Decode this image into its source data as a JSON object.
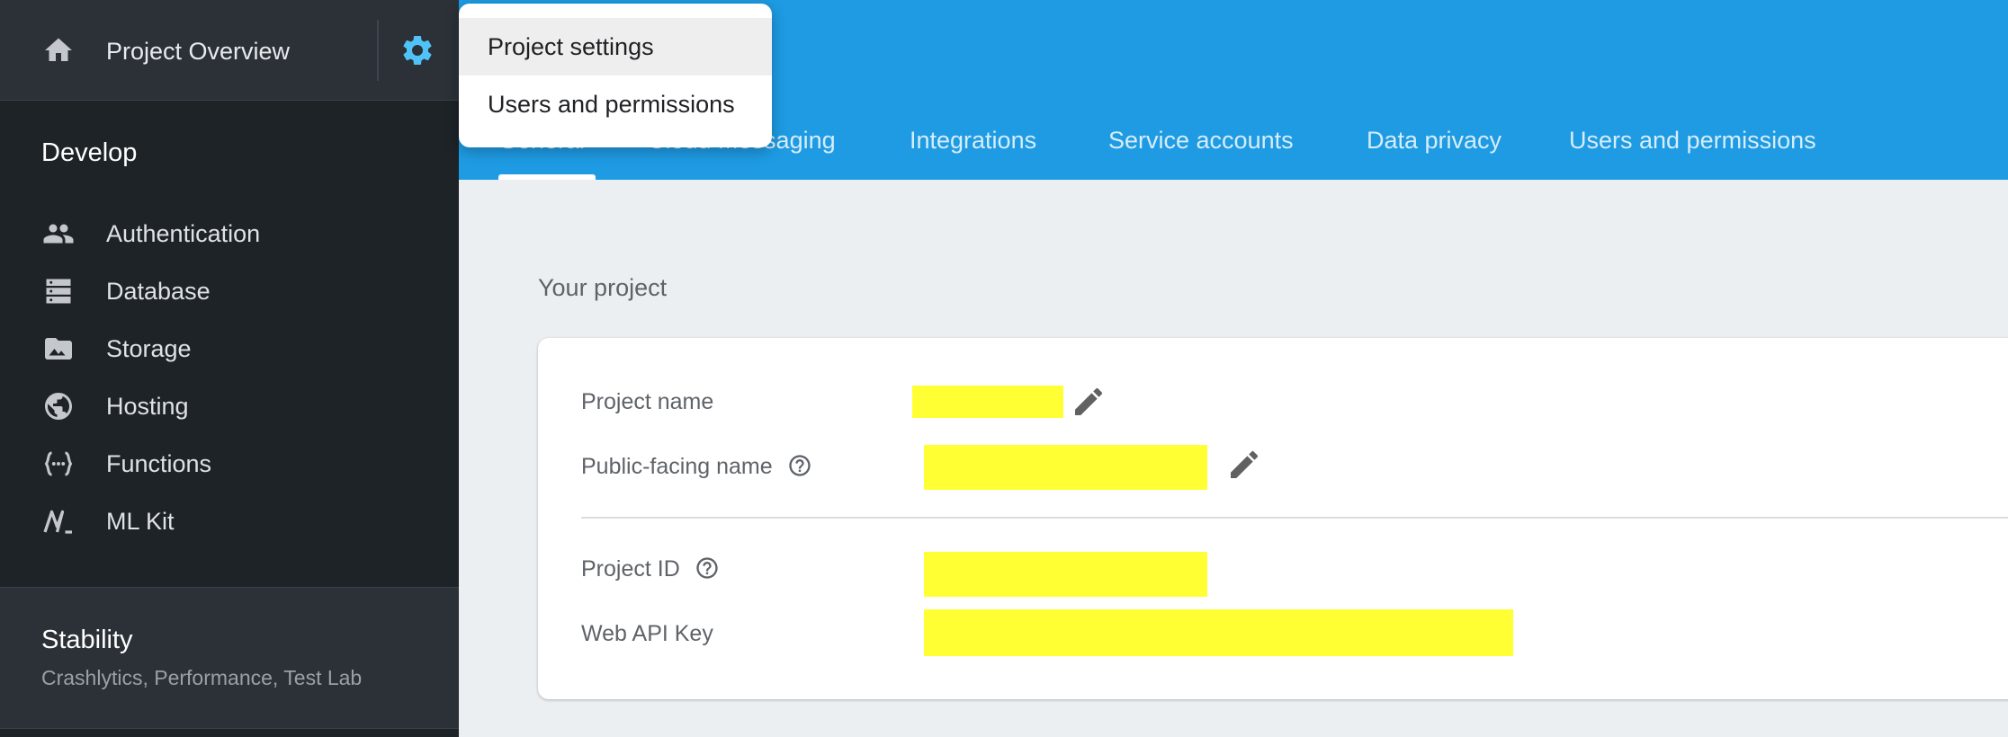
{
  "sidebar": {
    "overview_label": "Project Overview",
    "develop_title": "Develop",
    "develop_items": [
      {
        "label": "Authentication",
        "icon": "people-icon"
      },
      {
        "label": "Database",
        "icon": "database-icon"
      },
      {
        "label": "Storage",
        "icon": "storage-icon"
      },
      {
        "label": "Hosting",
        "icon": "globe-icon"
      },
      {
        "label": "Functions",
        "icon": "functions-icon"
      },
      {
        "label": "ML Kit",
        "icon": "ml-kit-icon"
      }
    ],
    "stability": {
      "title": "Stability",
      "subtitle": "Crashlytics, Performance, Test Lab"
    }
  },
  "dropdown": {
    "items": [
      "Project settings",
      "Users and permissions"
    ]
  },
  "header": {
    "tabs": [
      "General",
      "Cloud Messaging",
      "Integrations",
      "Service accounts",
      "Data privacy",
      "Users and permissions"
    ]
  },
  "project": {
    "heading": "Your project",
    "fields": [
      {
        "label": "Project name"
      },
      {
        "label": "Public-facing name"
      },
      {
        "label": "Project ID"
      },
      {
        "label": "Web API Key"
      }
    ]
  },
  "colors": {
    "header_blue": "#1e9be3",
    "sidebar_dark": "#1e2328",
    "redaction_yellow": "#ffff33",
    "gear_accent": "#4fc3f7"
  }
}
